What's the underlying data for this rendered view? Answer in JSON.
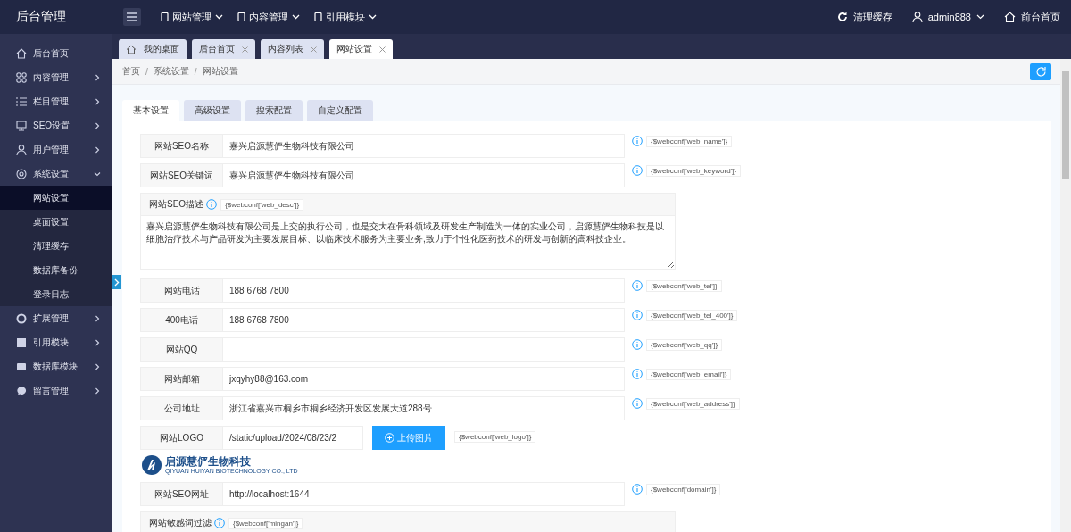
{
  "app_title": "后台管理",
  "top_menus": [
    {
      "label": "网站管理"
    },
    {
      "label": "内容管理"
    },
    {
      "label": "引用模块"
    }
  ],
  "top_actions": {
    "clear_cache": "清理缓存",
    "user": "admin888",
    "front_home": "前台首页"
  },
  "sidebar": {
    "items": [
      {
        "label": "后台首页"
      },
      {
        "label": "内容管理",
        "expanded": false
      },
      {
        "label": "栏目管理",
        "expanded": false
      },
      {
        "label": "SEO设置",
        "expanded": false
      },
      {
        "label": "用户管理",
        "expanded": false
      },
      {
        "label": "系统设置",
        "expanded": true,
        "children": [
          {
            "label": "网站设置",
            "selected": true
          },
          {
            "label": "桌面设置",
            "selected": false
          },
          {
            "label": "清理缓存",
            "selected": false
          },
          {
            "label": "数据库备份",
            "selected": false
          },
          {
            "label": "登录日志",
            "selected": false
          }
        ]
      },
      {
        "label": "扩展管理",
        "expanded": false
      },
      {
        "label": "引用模块",
        "expanded": false
      },
      {
        "label": "数据库模块",
        "expanded": false
      },
      {
        "label": "留言管理",
        "expanded": false
      }
    ]
  },
  "tabs": [
    {
      "label": "我的桌面",
      "selected": false,
      "closable": false
    },
    {
      "label": "后台首页",
      "selected": false,
      "closable": true
    },
    {
      "label": "内容列表",
      "selected": false,
      "closable": true
    },
    {
      "label": "网站设置",
      "selected": true,
      "closable": true
    }
  ],
  "breadcrumb": [
    "首页",
    "系统设置",
    "网站设置"
  ],
  "breadcrumb_separator": "/",
  "settings_tabs": [
    {
      "label": "基本设置",
      "selected": true
    },
    {
      "label": "高级设置",
      "selected": false
    },
    {
      "label": "搜索配置",
      "selected": false
    },
    {
      "label": "自定义配置",
      "selected": false
    }
  ],
  "fields": [
    {
      "kind": "input",
      "label": "网站SEO名称",
      "value": "嘉兴启源慧俨生物科技有限公司",
      "tag": "{$webconf['web_name']}"
    },
    {
      "kind": "input",
      "label": "网站SEO关键词",
      "value": "嘉兴启源慧俨生物科技有限公司",
      "tag": "{$webconf['web_keyword']}"
    },
    {
      "kind": "textarea",
      "label": "网站SEO描述",
      "tag": "{$webconf['web_desc']}",
      "value": "嘉兴启源慧俨生物科技有限公司是上交的执行公司，也是交大在骨科领域及研发生产制造为一体的实业公司，启源慧俨生物科技是以细胞治疗技术与产品研发为主要发展目标、以临床技术服务为主要业务,致力于个性化医药技术的研发与创新的高科技企业。"
    },
    {
      "kind": "input",
      "label": "网站电话",
      "value": "188 6768 7800",
      "tag": "{$webconf['web_tel']}"
    },
    {
      "kind": "input",
      "label": "400电话",
      "value": "188 6768 7800",
      "tag": "{$webconf['web_tel_400']}"
    },
    {
      "kind": "input",
      "label": "网站QQ",
      "tag": "{$webconf['web_qq']}"
    },
    {
      "kind": "input",
      "label": "网站邮箱",
      "value": "jxqyhy88@163.com",
      "tag": "{$webconf['web_email']}"
    },
    {
      "kind": "input",
      "label": "公司地址",
      "value": "浙江省嘉兴市桐乡市桐乡经济开发区发展大道288号",
      "tag": "{$webconf['web_address']}"
    },
    {
      "kind": "upload",
      "label": "网站LOGO",
      "value": "/static/upload/2024/08/23/2",
      "button": "上传图片",
      "tag": "{$webconf['web_logo']}",
      "logo_text": "启源慧俨生物科技",
      "logo_subtext": "QIYUAN HUIYAN BIOTECHNOLOGY CO., LTD"
    },
    {
      "kind": "input",
      "label": "网站SEO网址",
      "value": "http://localhost:1644",
      "tag": "{$webconf['domain']}"
    },
    {
      "kind": "textarea",
      "label": "网站敏感词过滤",
      "tag": "{$webconf['mingan']}"
    }
  ]
}
